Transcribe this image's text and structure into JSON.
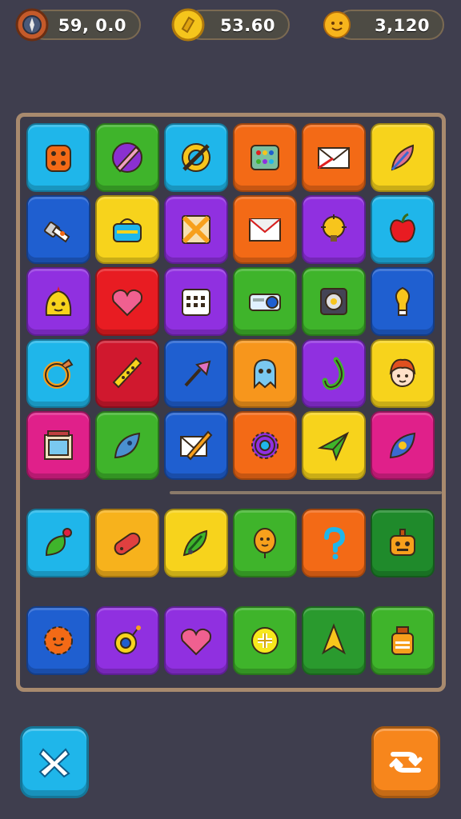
{
  "resources": {
    "compass": {
      "value": "59, 0.0",
      "icon": "compass-coin-icon"
    },
    "gold": {
      "value": "53.60",
      "icon": "gold-coin-icon"
    },
    "sun": {
      "value": "3,120",
      "icon": "sun-coin-icon"
    }
  },
  "colors": {
    "background": "#3f3e4e",
    "board_border": "#a88a6e",
    "cyan": "#1fb6ea",
    "green": "#3fb42b",
    "orange": "#f36a16",
    "yellow": "#f7d31c",
    "blue": "#1f5fd0",
    "purple": "#9030e0",
    "red": "#e81c22",
    "magenta": "#e0208a"
  },
  "board": {
    "rows": [
      [
        {
          "color": "#1fb6ea",
          "icon": "dice-icon"
        },
        {
          "color": "#3fb42b",
          "icon": "pen-disc-icon"
        },
        {
          "color": "#1fb6ea",
          "icon": "crossed-ring-icon"
        },
        {
          "color": "#f36a16",
          "icon": "color-palette-icon"
        },
        {
          "color": "#f36a16",
          "icon": "envelope-icon"
        },
        {
          "color": "#f7d31c",
          "icon": "feather-icon"
        }
      ],
      [
        {
          "color": "#1f5fd0",
          "icon": "usb-key-icon"
        },
        {
          "color": "#f7d31c",
          "icon": "lunch-box-icon"
        },
        {
          "color": "#9030e0",
          "icon": "crossed-pencils-icon"
        },
        {
          "color": "#f36a16",
          "icon": "mail-icon"
        },
        {
          "color": "#9030e0",
          "icon": "gear-bulb-icon"
        },
        {
          "color": "#1fb6ea",
          "icon": "apple-icon"
        }
      ],
      [
        {
          "color": "#9030e0",
          "icon": "chick-face-icon"
        },
        {
          "color": "#e81c22",
          "icon": "heart-icon"
        },
        {
          "color": "#9030e0",
          "icon": "calendar-icon"
        },
        {
          "color": "#3fb42b",
          "icon": "projector-icon"
        },
        {
          "color": "#3fb42b",
          "icon": "speaker-icon"
        },
        {
          "color": "#1f5fd0",
          "icon": "bulb-icon"
        }
      ],
      [
        {
          "color": "#1fb6ea",
          "icon": "ring-icon"
        },
        {
          "color": "#d0182e",
          "icon": "flute-icon"
        },
        {
          "color": "#1f5fd0",
          "icon": "dart-icon"
        },
        {
          "color": "#f7961c",
          "icon": "ghost-icon"
        },
        {
          "color": "#9030e0",
          "icon": "hook-icon"
        },
        {
          "color": "#f7d31c",
          "icon": "girl-face-icon"
        }
      ],
      [
        {
          "color": "#e0208a",
          "icon": "frame-icon"
        },
        {
          "color": "#3fb42b",
          "icon": "leaf-icon"
        },
        {
          "color": "#1f5fd0",
          "icon": "pencil-envelope-icon"
        },
        {
          "color": "#f36a16",
          "icon": "cog-icon"
        },
        {
          "color": "#f7d31c",
          "icon": "paper-plane-icon"
        },
        {
          "color": "#e0208a",
          "icon": "diamond-gem-icon"
        }
      ],
      [
        {
          "color": "#1fb6ea",
          "icon": "berry-leaf-icon"
        },
        {
          "color": "#f7b21c",
          "icon": "sausage-icon"
        },
        {
          "color": "#f7d31c",
          "icon": "seed-icon"
        },
        {
          "color": "#3fb42b",
          "icon": "balloon-face-icon"
        },
        {
          "color": "#f36a16",
          "icon": "question-icon"
        },
        {
          "color": "#1f8a2b",
          "icon": "robot-icon"
        }
      ],
      [
        {
          "color": "#1f5fd0",
          "icon": "sun-face-icon"
        },
        {
          "color": "#9030e0",
          "icon": "bomb-icon"
        },
        {
          "color": "#9030e0",
          "icon": "heart-icon"
        },
        {
          "color": "#3fb42b",
          "icon": "plus-coin-icon"
        },
        {
          "color": "#2a9a2e",
          "icon": "arrow-up-icon"
        },
        {
          "color": "#3fb42b",
          "icon": "jar-icon"
        }
      ]
    ]
  },
  "controls": {
    "close": {
      "icon": "close-icon",
      "color": "#1fb6ea"
    },
    "shuffle": {
      "icon": "shuffle-icon",
      "color": "#f7861c"
    }
  }
}
